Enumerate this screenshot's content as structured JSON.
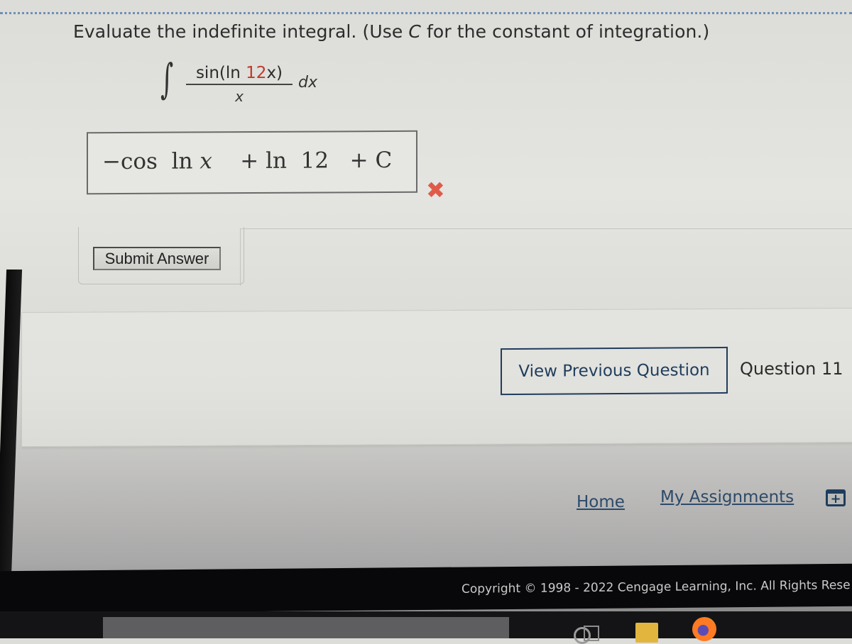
{
  "question": {
    "prompt_prefix": "Evaluate the indefinite integral. (Use ",
    "prompt_var": "C",
    "prompt_suffix": " for the constant of integration.)",
    "integrand_numerator_prefix": "sin(ln ",
    "integrand_numerator_highlight": "12",
    "integrand_numerator_suffix": "x)",
    "integrand_denominator": "x",
    "differential": "dx",
    "highlight_color": "#c0392b"
  },
  "answer": {
    "part1": "−cos  ln ",
    "part1_var": "x",
    "part2": "    + ln  12   + ",
    "part2_var": "C",
    "status": "incorrect",
    "status_icon": "✖"
  },
  "buttons": {
    "submit_label": "Submit Answer",
    "prev_label": "View Previous Question"
  },
  "navigation": {
    "question_label": "Question 11"
  },
  "footer": {
    "home_label": "Home",
    "assignments_label": "My Assignments",
    "calendar_icon": "+",
    "copyright": "Copyright © 1998 - 2022 Cengage Learning, Inc. All Rights Rese"
  },
  "colors": {
    "link": "#2d4a68",
    "button_border": "#1f3d5c",
    "wrong": "#e05a4a"
  }
}
